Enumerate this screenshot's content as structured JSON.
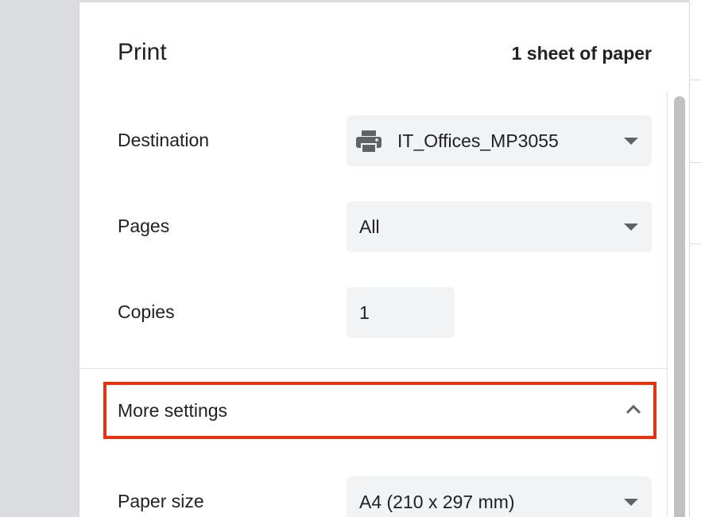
{
  "dialog": {
    "title": "Print",
    "sheet_count": "1 sheet of paper"
  },
  "destination": {
    "label": "Destination",
    "value": "IT_Offices_MP3055",
    "icon": "printer-icon"
  },
  "pages": {
    "label": "Pages",
    "value": "All"
  },
  "copies": {
    "label": "Copies",
    "value": "1"
  },
  "more_settings": {
    "label": "More settings",
    "icon": "chevron-up-icon",
    "highlight_color": "#e8310f"
  },
  "paper_size": {
    "label": "Paper size",
    "value": "A4 (210 x 297 mm)"
  },
  "colors": {
    "field_bg": "#f1f3f4",
    "text": "#202124",
    "icon": "#5f6368",
    "backdrop": "#dadce0"
  }
}
